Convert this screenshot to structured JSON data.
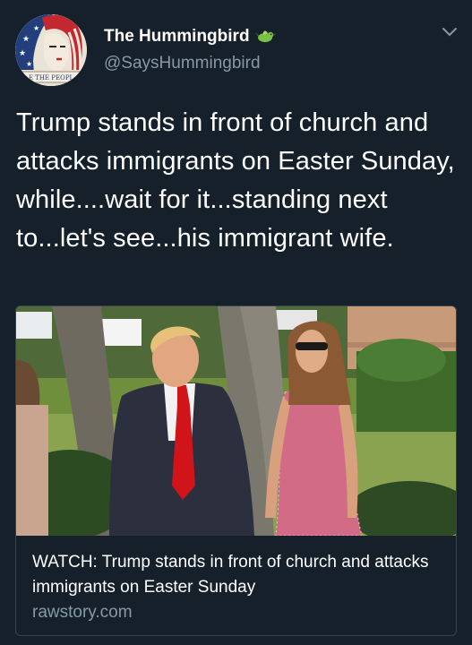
{
  "author": {
    "display_name": "The Hummingbird",
    "handle": "@SaysHummingbird",
    "avatar_caption": "E THE PEOPL",
    "avatar_icon": "we-the-people-portrait"
  },
  "tweet": {
    "text": "Trump stands in front of church and attacks immigrants on Easter Sunday, while....wait for it...standing next to...let's see...his immigrant wife."
  },
  "card": {
    "title": "WATCH: Trump stands in front of church and attacks immigrants on Easter Sunday",
    "domain": "rawstory.com"
  },
  "colors": {
    "background": "#15202b",
    "secondary_text": "#8899a6",
    "border": "#38444d",
    "bird_green": "#7cc242"
  }
}
